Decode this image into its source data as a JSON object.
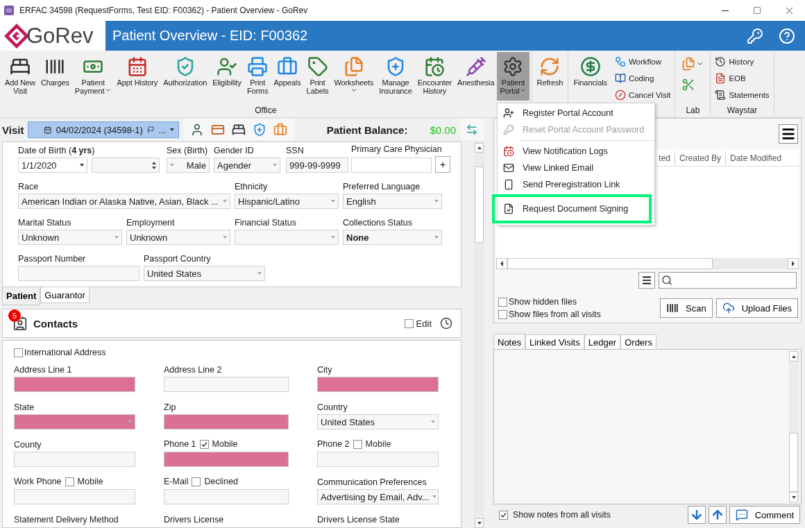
{
  "window": {
    "title": "ERFAC 34598 (RequestForms, Test EID: F00362) - Patient Overview - GoRev"
  },
  "header": {
    "logo_text": "GoRev",
    "title": "Patient Overview - EID: F00362"
  },
  "ribbon": {
    "groups": [
      {
        "label": "Office",
        "items": [
          {
            "kind": "large",
            "lines": [
              "Add New",
              "Visit"
            ],
            "dropdown": false,
            "selected": false
          },
          {
            "kind": "large",
            "lines": [
              "Charges"
            ],
            "dropdown": false,
            "selected": false
          },
          {
            "kind": "large",
            "lines": [
              "Patient",
              "Payment"
            ],
            "dropdown": true,
            "selected": false
          },
          {
            "kind": "large",
            "lines": [
              "Appt History"
            ],
            "dropdown": false,
            "selected": false
          },
          {
            "kind": "large",
            "lines": [
              "Authorization"
            ],
            "dropdown": false,
            "selected": false
          },
          {
            "kind": "large",
            "lines": [
              "Eligibility"
            ],
            "dropdown": false,
            "selected": false
          },
          {
            "kind": "large",
            "lines": [
              "Print",
              "Forms"
            ],
            "dropdown": false,
            "selected": false
          },
          {
            "kind": "large",
            "lines": [
              "Appeals"
            ],
            "dropdown": false,
            "selected": false
          },
          {
            "kind": "large",
            "lines": [
              "Print",
              "Labels"
            ],
            "dropdown": false,
            "selected": false
          },
          {
            "kind": "large",
            "lines": [
              "Worksheets"
            ],
            "dropdown": true,
            "selected": false
          },
          {
            "kind": "large",
            "lines": [
              "Manage",
              "Insurance"
            ],
            "dropdown": false,
            "selected": false
          },
          {
            "kind": "large",
            "lines": [
              "Encounter",
              "History"
            ],
            "dropdown": false,
            "selected": false
          },
          {
            "kind": "large",
            "lines": [
              "Anesthesia"
            ],
            "dropdown": false,
            "selected": false
          },
          {
            "kind": "large",
            "lines": [
              "Patient",
              "Portal"
            ],
            "dropdown": true,
            "selected": true
          }
        ]
      },
      {
        "items": [
          {
            "kind": "large",
            "lines": [
              "Refresh"
            ],
            "dropdown": false,
            "selected": false
          }
        ]
      },
      {
        "items": [
          {
            "kind": "large",
            "lines": [
              "Financials"
            ],
            "dropdown": false,
            "selected": false
          },
          {
            "kind": "small",
            "lines": [
              "Workflow"
            ],
            "dropdown": false,
            "selected": false
          },
          {
            "kind": "small",
            "lines": [
              "Coding"
            ],
            "dropdown": false,
            "selected": false
          },
          {
            "kind": "small",
            "lines": [
              "Cancel Visit"
            ],
            "dropdown": false,
            "selected": false
          }
        ]
      },
      {
        "label": "Lab",
        "items": [
          {
            "kind": "icon",
            "dropdown": true,
            "selected": false
          },
          {
            "kind": "icon",
            "dropdown": false,
            "selected": false
          }
        ]
      },
      {
        "label": "Waystar",
        "items": [
          {
            "kind": "small",
            "lines": [
              "History"
            ],
            "dropdown": false,
            "selected": false
          },
          {
            "kind": "small",
            "lines": [
              "EOB"
            ],
            "dropdown": false,
            "selected": false
          },
          {
            "kind": "small",
            "lines": [
              "Statements"
            ],
            "dropdown": false,
            "selected": false
          }
        ]
      }
    ]
  },
  "portal_menu": {
    "items": [
      {
        "kind": "item",
        "label": "Register Portal Account",
        "disabled": false,
        "highlighted": false
      },
      {
        "kind": "item",
        "label": "Reset Portal Account Password",
        "disabled": true,
        "highlighted": false
      },
      {
        "kind": "separator"
      },
      {
        "kind": "item",
        "label": "View Notification Logs",
        "disabled": false,
        "highlighted": false
      },
      {
        "kind": "item",
        "label": "View Linked Email",
        "disabled": false,
        "highlighted": false
      },
      {
        "kind": "item",
        "label": "Send Preregistration Link",
        "disabled": false,
        "highlighted": false
      },
      {
        "kind": "item",
        "label": "Request Document Signing",
        "disabled": false,
        "highlighted": true
      }
    ]
  },
  "visit_bar": {
    "label": "Visit",
    "value": "04/02/2024 (34598-1)",
    "ellipsis": "...",
    "balance_label": "Patient Balance:",
    "balance": "$0.00"
  },
  "patient_form": {
    "rows": [
      {
        "fields": [
          {
            "kind": "date",
            "label": "Date of Birth (**4 yrs**)",
            "value": "1/1/2020"
          },
          {
            "kind": "spinner"
          },
          {
            "kind": "dropdown-left",
            "label": "Sex (Birth)",
            "value": "Male"
          },
          {
            "kind": "dropdown",
            "label": "Gender ID",
            "value": "Agender"
          },
          {
            "kind": "text",
            "label": "SSN",
            "value": "999-99-9999"
          },
          {
            "kind": "text-add",
            "label": "Primary Care Physician",
            "button": "+"
          }
        ]
      },
      {
        "fields": [
          {
            "kind": "dropdown",
            "label": "Race",
            "value": "American Indian or Alaska Native, Asian, Black ..."
          },
          {
            "kind": "dropdown",
            "label": "Ethnicity",
            "value": "Hispanic/Latino"
          },
          {
            "kind": "dropdown",
            "label": "Preferred Language",
            "value": "English"
          }
        ]
      },
      {
        "fields": [
          {
            "kind": "dropdown",
            "label": "Marital Status",
            "value": "Unknown",
            "bold": false
          },
          {
            "kind": "dropdown",
            "label": "Employment",
            "value": "Unknown",
            "bold": false
          },
          {
            "kind": "dropdown",
            "label": "Financial Status"
          },
          {
            "kind": "dropdown",
            "label": "Collections Status",
            "value": "None",
            "bold": true
          }
        ]
      },
      {
        "fields": [
          {
            "kind": "text",
            "label": "Passport Number"
          },
          {
            "kind": "dropdown",
            "label": "Passport Country",
            "value": "United States"
          }
        ]
      }
    ],
    "tabs": [
      {
        "label": "Patient",
        "selected": true
      },
      {
        "label": "Guarantor",
        "selected": false
      }
    ]
  },
  "contacts": {
    "badge": "5",
    "title": "Contacts",
    "edit": {
      "label": "Edit",
      "checked": false
    },
    "international": {
      "label": "International Address",
      "checked": false
    },
    "rows": [
      [
        {
          "kind": "text",
          "label": "Address Line 1",
          "required": true
        },
        {
          "kind": "text",
          "label": "Address Line 2",
          "required": false
        },
        {
          "kind": "text",
          "label": "City",
          "required": true
        }
      ],
      [
        {
          "kind": "dropdown",
          "label": "State",
          "required": true
        },
        {
          "kind": "text",
          "label": "Zip",
          "required": true
        },
        {
          "kind": "dropdown",
          "label": "Country",
          "value": "United States",
          "required": false
        }
      ],
      [
        {
          "kind": "text",
          "label": "County",
          "required": false
        },
        {
          "kind": "text",
          "label": "Phone 1",
          "required": true,
          "checkbox": {
            "label": "Mobile",
            "checked": true
          }
        },
        {
          "kind": "text",
          "label": "Phone 2",
          "required": false,
          "checkbox": {
            "label": "Mobile",
            "checked": false
          }
        }
      ],
      [
        {
          "kind": "text",
          "label": "Work Phone",
          "required": false,
          "checkbox": {
            "label": "Mobile",
            "checked": false
          }
        },
        {
          "kind": "text",
          "label": "E-Mail",
          "required": false,
          "checkbox": {
            "label": "Declined",
            "checked": false
          }
        },
        {
          "kind": "dropdown",
          "label": "Communication Preferences",
          "value": "Advertising by Email, Adv...",
          "required": false
        }
      ],
      [
        {
          "kind": "label",
          "label": "Statement Delivery Method"
        },
        {
          "kind": "label",
          "label": "Drivers License"
        },
        {
          "kind": "label",
          "label": "Drivers License State"
        }
      ]
    ]
  },
  "documents": {
    "columns": [
      "ted",
      "Created By",
      "Date Modified"
    ],
    "options": [
      {
        "label": "Show hidden files",
        "checked": false
      },
      {
        "label": "Show files from all visits",
        "checked": false
      }
    ],
    "buttons": [
      "Scan",
      "Upload Files"
    ]
  },
  "notes": {
    "tabs": [
      {
        "label": "Notes",
        "selected": true
      },
      {
        "label": "Linked Visits",
        "selected": false
      },
      {
        "label": "Ledger",
        "selected": false
      },
      {
        "label": "Orders",
        "selected": false
      }
    ],
    "show_all": {
      "label": "Show notes from all visits",
      "checked": true
    },
    "comment_button": "Comment"
  }
}
